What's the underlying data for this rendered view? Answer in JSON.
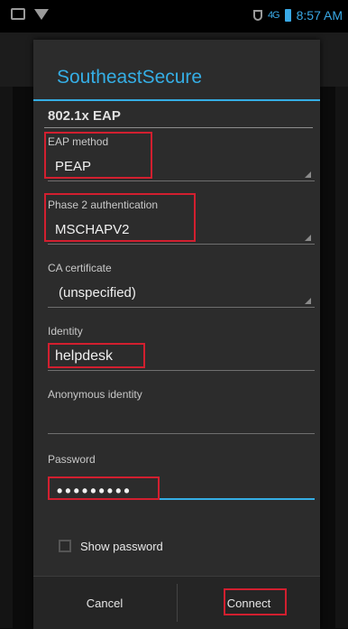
{
  "status_bar": {
    "time": "8:57 AM",
    "signal_text": "4G"
  },
  "dialog": {
    "title": "SoutheastSecure",
    "section_title": "802.1x EAP",
    "fields": {
      "eap_method": {
        "label": "EAP method",
        "value": "PEAP"
      },
      "phase2": {
        "label": "Phase 2 authentication",
        "value": "MSCHAPV2"
      },
      "ca_certificate": {
        "label": "CA certificate",
        "value": "(unspecified)"
      },
      "identity": {
        "label": "Identity",
        "value": "helpdesk"
      },
      "anonymous_identity": {
        "label": "Anonymous identity",
        "value": ""
      },
      "password": {
        "label": "Password",
        "value": "•••••••••"
      }
    },
    "show_password": {
      "label": "Show password",
      "checked": false
    },
    "buttons": {
      "cancel": "Cancel",
      "connect": "Connect"
    }
  },
  "colors": {
    "accent": "#35aee5",
    "highlight": "#d21f2f",
    "dialog_bg": "#2c2c2c"
  }
}
